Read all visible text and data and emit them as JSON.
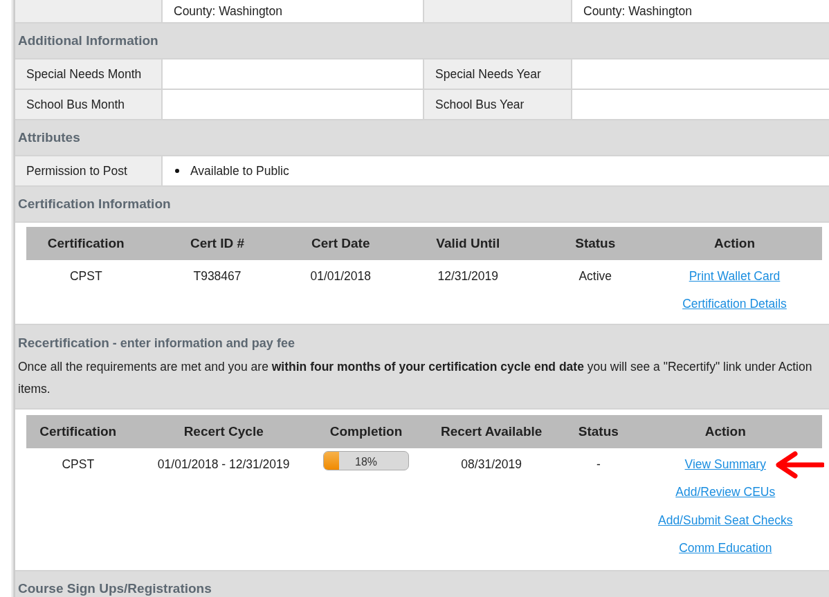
{
  "address_row": [
    "County: Washington",
    "County: Washington"
  ],
  "additional_information": {
    "title": "Additional Information",
    "rows": [
      {
        "label": "Special Needs Month",
        "label_2": "Special Needs Year"
      },
      {
        "label": "School Bus Month",
        "label_2": "School Bus Year"
      }
    ]
  },
  "attributes": {
    "title": "Attributes",
    "rows": [
      {
        "label": "Permission to Post",
        "values": [
          "Available to Public"
        ]
      }
    ]
  },
  "certification_information": {
    "title": "Certification Information",
    "columns": [
      "Certification",
      "Cert ID #",
      "Cert Date",
      "Valid Until",
      "Status",
      "Action"
    ],
    "rows": [
      {
        "cells": [
          "CPST",
          "T938467",
          "01/01/2018",
          "12/31/2019",
          "Active"
        ],
        "actions": [
          {
            "text": "Print Wallet Card",
            "arrow": false
          },
          {
            "text": "Certification Details",
            "arrow": false
          }
        ]
      }
    ]
  },
  "recertification": {
    "title": "Recertification",
    "subtitle": "- enter information and pay fee",
    "note": "Once all the requirements are met and you are **within four months of your certification cycle end date** you will see a \"Recertify\" link under Action items.",
    "columns": [
      "Certification",
      "Recert Cycle",
      "Completion",
      "Recert Available",
      "Status",
      "Action"
    ],
    "rows": [
      {
        "certification": "CPST",
        "cycle": "01/01/2018 - 12/31/2019",
        "completion": {
          "level": 0.18,
          "reading": "18%"
        },
        "available": "08/31/2019",
        "status": "-",
        "actions": [
          {
            "text": "View Summary",
            "arrow": true
          },
          {
            "text": "Add/Review CEUs",
            "arrow": false
          },
          {
            "text": "Add/Submit Seat Checks",
            "arrow": false
          },
          {
            "text": "Comm Education",
            "arrow": false
          }
        ]
      }
    ]
  },
  "course_sign_ups": {
    "title": "Course Sign Ups/Registrations"
  }
}
